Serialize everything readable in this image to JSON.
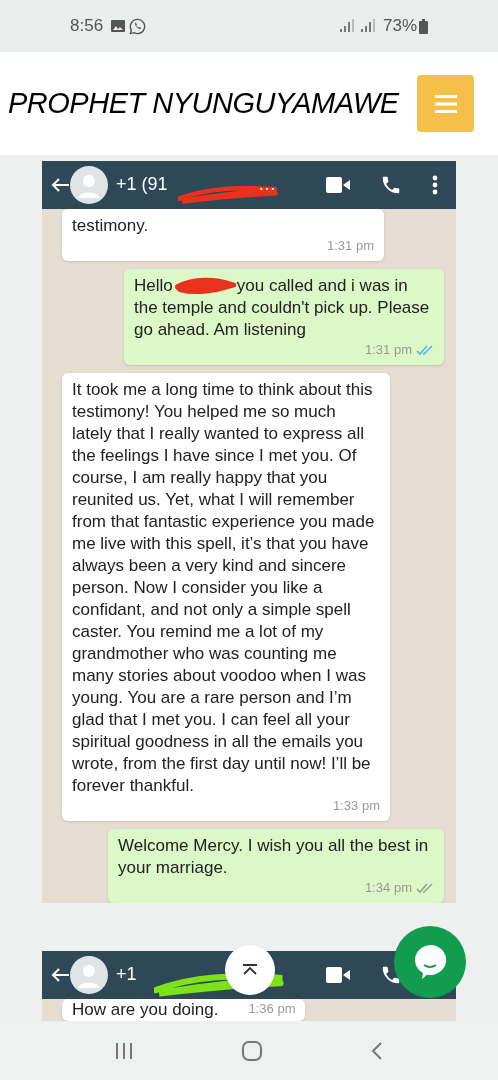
{
  "status_bar": {
    "time": "8:56",
    "battery": "73%"
  },
  "site": {
    "title": "PROPHET NYUNGUYAMAWE"
  },
  "screenshots": [
    {
      "contact": "+1 (91",
      "contact_tail": "…",
      "messages": [
        {
          "kind": "received",
          "text": "testimony.",
          "time": "1:31 pm"
        },
        {
          "kind": "sent",
          "text_before": "Hello",
          "text_after": "you called and i was in",
          "text": "the temple and couldn't pick up. Please go ahead. Am listening",
          "time": "1:31 pm",
          "read": true
        },
        {
          "kind": "received",
          "text": "It took me a long time to think about this testimony! You helped me so much lately that I really wanted to express all the feelings I have since I met you. Of course, I am really happy that you reunited us. Yet, what I will remember from that fantastic experience you made me live with this spell, it’s that you have always been a very kind and sincere person. Now I consider you like a confidant, and not only a simple spell caster. You remind me a lot of my grandmother who was counting me many stories about voodoo when I was young. You are a rare person and I’m glad that I met you. I can feel all your spiritual goodness in all the emails you wrote, from the first day until now! I’ll be forever thankful.",
          "time": "1:33 pm"
        },
        {
          "kind": "sent",
          "text": "Welcome Mercy. I wish you all the best in your marriage.",
          "time": "1:34 pm",
          "read": false
        }
      ]
    },
    {
      "contact": "+1",
      "messages": [
        {
          "kind": "received",
          "text": "How are you doing.",
          "time": "1:36 pm"
        }
      ]
    }
  ]
}
